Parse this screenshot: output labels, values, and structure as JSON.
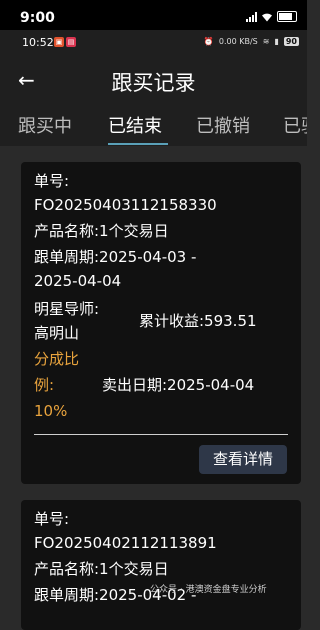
{
  "status_bar": {
    "time": "9:00"
  },
  "inner_status": {
    "time": "10:52",
    "network_speed": "0.00 KB/S",
    "battery": "90"
  },
  "header": {
    "back_glyph": "←",
    "title": "跟买记录"
  },
  "tabs": [
    {
      "label": "跟买中",
      "active": false
    },
    {
      "label": "已结束",
      "active": true
    },
    {
      "label": "已撤销",
      "active": false
    },
    {
      "label": "已驳",
      "active": false
    }
  ],
  "records": [
    {
      "order_label": "单号:",
      "order_no": "FO20250403112158330",
      "product": "产品名称:1个交易日",
      "period_line1": "跟单周期:2025-04-03 -",
      "period_line2": "2025-04-04",
      "mentor_label": "明星导师:",
      "mentor_name": "高明山",
      "profit": "累计收益:593.51",
      "share_line1": "分成比",
      "share_line2": "例:",
      "share_value": "10%",
      "sell_date": "卖出日期:2025-04-04",
      "detail_button": "查看详情"
    },
    {
      "order_label": "单号:",
      "order_no": "FO20250402112113891",
      "product": "产品名称:1个交易日",
      "period_line1": "跟单周期:2025-04-02 -"
    }
  ],
  "watermark": "公众号 · 港澳资金盘专业分析",
  "colors": {
    "accent_orange": "#e8a33d",
    "tab_indicator": "#5aa0b8",
    "button_bg": "#2e3748",
    "card_bg": "#111111"
  }
}
